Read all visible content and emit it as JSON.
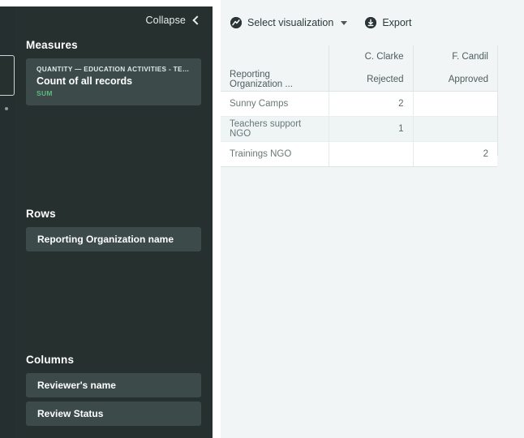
{
  "sidebar": {
    "collapse_label": "Collapse",
    "collapse_icon": "chevron-left-icon",
    "measures": {
      "title": "Measures",
      "card": {
        "kicker": "QUANTITY — EDUCATION ACTIVITIES - TEACHERS TRA...",
        "title": "Count of all records",
        "aggregation": "SUM",
        "aggregation_color": "#5fb87f"
      }
    },
    "rows": {
      "title": "Rows",
      "fields": [
        {
          "label": "Reporting Organization name"
        }
      ]
    },
    "columns": {
      "title": "Columns",
      "fields": [
        {
          "label": "Reviewer's name"
        },
        {
          "label": "Review Status"
        }
      ]
    },
    "background_color": "#26302f",
    "card_color": "#3c4a4a"
  },
  "toolbar": {
    "select_visualization": {
      "label": "Select visualization",
      "icon": "visualization-icon",
      "caret": "chevron-down-icon"
    },
    "export": {
      "label": "Export",
      "icon": "export-icon"
    }
  },
  "chart_data": {
    "type": "table",
    "title": "",
    "corner_label": "Reporting Organization ...",
    "column_group_header": "Reviewer's name",
    "column_sub_header": "Review Status",
    "columns": [
      {
        "reviewer": "C. Clarke",
        "status": "Rejected"
      },
      {
        "reviewer": "F. Candil",
        "status": "Approved"
      }
    ],
    "categories": [
      "Sunny Camps",
      "Teachers support NGO",
      "Trainings NGO"
    ],
    "series": [
      {
        "name": "C. Clarke / Rejected",
        "values": [
          2,
          1,
          null
        ]
      },
      {
        "name": "F. Candil / Approved",
        "values": [
          null,
          null,
          2
        ]
      }
    ],
    "rows": [
      {
        "label": "Sunny Camps",
        "cells": [
          "2",
          ""
        ]
      },
      {
        "label": "Teachers support NGO",
        "cells": [
          "1",
          ""
        ]
      },
      {
        "label": "Trainings NGO",
        "cells": [
          "",
          "2"
        ]
      }
    ]
  }
}
